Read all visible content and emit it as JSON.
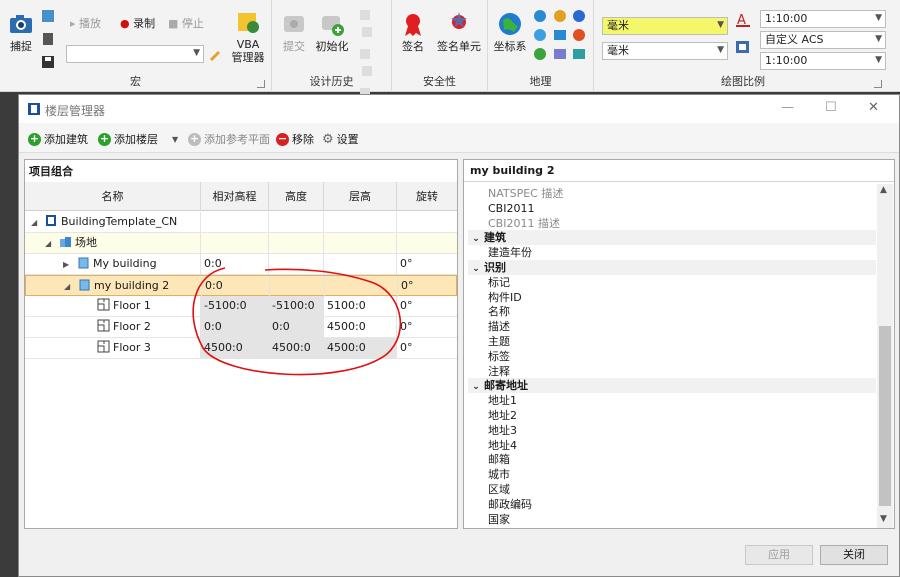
{
  "ribbon": {
    "capture": {
      "label": "捕捉"
    },
    "playback": {
      "play": "播放",
      "record": "录制",
      "stop": "停止"
    },
    "vba": {
      "label_line1": "VBA",
      "label_line2": "管理器"
    },
    "group_macro": "宏",
    "history": {
      "commit": "提交",
      "initialize": "初始化"
    },
    "group_history": "设计历史",
    "security": {
      "sign": "签名",
      "sign_unit": "签名单元"
    },
    "group_security": "安全性",
    "geo": {
      "coord_sys": "坐标系"
    },
    "group_geo": "地理",
    "scale": {
      "unit1": "毫米",
      "unit2": "毫米",
      "ratio1": "1:10:00",
      "acs": "自定义 ACS",
      "ratio2": "1:10:00"
    },
    "group_scale": "绘图比例"
  },
  "dialog": {
    "title": "楼层管理器",
    "toolbar": {
      "add_building": "添加建筑",
      "add_floor": "添加楼层",
      "add_ref_plane": "添加参考平面",
      "remove": "移除",
      "settings": "设置"
    },
    "left": {
      "header": "项目组合",
      "columns": [
        "名称",
        "相对高程",
        "高度",
        "层高",
        "旋转"
      ],
      "rows": [
        {
          "name": "BuildingTemplate_CN",
          "elev": "",
          "height": "",
          "floor_h": "",
          "rot": ""
        },
        {
          "name": "场地",
          "elev": "",
          "height": "",
          "floor_h": "",
          "rot": ""
        },
        {
          "name": "My building",
          "elev": "0:0",
          "height": "",
          "floor_h": "",
          "rot": "0°"
        },
        {
          "name": "my building 2",
          "elev": "0:0",
          "height": "",
          "floor_h": "",
          "rot": "0°"
        },
        {
          "name": "Floor 1",
          "elev": "-5100:0",
          "height": "-5100:0",
          "floor_h": "5100:0",
          "rot": "0°"
        },
        {
          "name": "Floor 2",
          "elev": "0:0",
          "height": "0:0",
          "floor_h": "4500:0",
          "rot": "0°"
        },
        {
          "name": "Floor 3",
          "elev": "4500:0",
          "height": "4500:0",
          "floor_h": "4500:0",
          "rot": "0°"
        }
      ]
    },
    "right": {
      "header": "my building 2",
      "items": [
        {
          "t": "NATSPEC 描述",
          "cat": false,
          "grey": true
        },
        {
          "t": "CBI2011",
          "cat": false,
          "grey": false
        },
        {
          "t": "CBI2011 描述",
          "cat": false,
          "grey": true
        },
        {
          "t": "建筑",
          "cat": true
        },
        {
          "t": "建造年份",
          "cat": false
        },
        {
          "t": "识别",
          "cat": true
        },
        {
          "t": "标记",
          "cat": false
        },
        {
          "t": "构件ID",
          "cat": false
        },
        {
          "t": "名称",
          "cat": false
        },
        {
          "t": "描述",
          "cat": false
        },
        {
          "t": "主题",
          "cat": false
        },
        {
          "t": "标签",
          "cat": false
        },
        {
          "t": "注释",
          "cat": false
        },
        {
          "t": "邮寄地址",
          "cat": true
        },
        {
          "t": "地址1",
          "cat": false
        },
        {
          "t": "地址2",
          "cat": false
        },
        {
          "t": "地址3",
          "cat": false
        },
        {
          "t": "地址4",
          "cat": false
        },
        {
          "t": "邮箱",
          "cat": false
        },
        {
          "t": "城市",
          "cat": false
        },
        {
          "t": "区域",
          "cat": false
        },
        {
          "t": "邮政编码",
          "cat": false
        },
        {
          "t": "国家",
          "cat": false
        }
      ]
    },
    "buttons": {
      "apply": "应用",
      "close": "关闭"
    }
  },
  "colors": {
    "highlight_yellow": "#f5f76a",
    "selected_row": "#fde6b8",
    "annotation_red": "#e01010"
  }
}
